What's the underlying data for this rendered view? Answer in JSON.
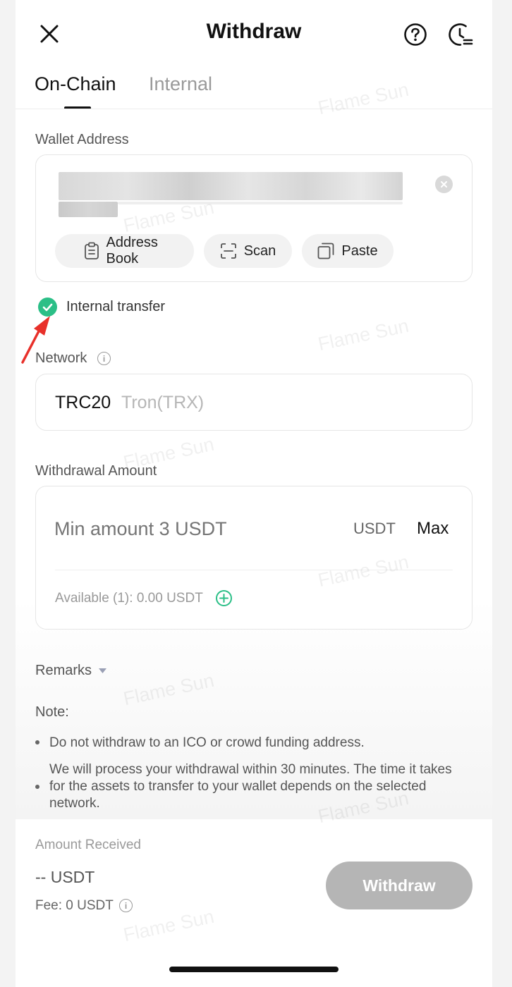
{
  "header": {
    "title": "Withdraw",
    "close_icon": "close-icon",
    "help_icon": "question-circle-icon",
    "history_icon": "clock-history-icon"
  },
  "tabs": [
    {
      "label": "On-Chain",
      "active": true
    },
    {
      "label": "Internal",
      "active": false
    }
  ],
  "wallet": {
    "label": "Wallet Address",
    "buttons": {
      "address_book": "Address Book",
      "scan": "Scan",
      "paste": "Paste"
    }
  },
  "internal_transfer": {
    "label": "Internal transfer",
    "checked": true
  },
  "network": {
    "label": "Network",
    "code": "TRC20",
    "name": "Tron(TRX)"
  },
  "amount": {
    "label": "Withdrawal Amount",
    "placeholder": "Min amount 3 USDT",
    "currency": "USDT",
    "max_label": "Max",
    "available": "Available (1): 0.00 USDT"
  },
  "remarks": {
    "label": "Remarks"
  },
  "note": {
    "title": "Note:",
    "items": [
      "Do not withdraw to an ICO or crowd funding address.",
      "We will process your withdrawal within 30 minutes. The time it takes for the assets to transfer to your wallet depends on the selected network."
    ]
  },
  "footer": {
    "received_label": "Amount Received",
    "received_value": "-- USDT",
    "fee": "Fee: 0 USDT",
    "withdraw_button": "Withdraw"
  },
  "watermark_text": "Flame Sun",
  "colors": {
    "accent_green": "#2bbf87",
    "disabled_button": "#b5b5b5",
    "annotation_arrow": "#e8302a"
  }
}
